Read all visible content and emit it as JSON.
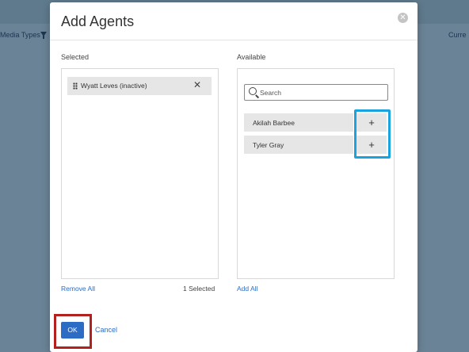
{
  "backdrop": {
    "media_types_label": "Media Types",
    "right_label_partial": "Curre"
  },
  "modal": {
    "title": "Add Agents",
    "close_icon": "close-circle-icon"
  },
  "selected": {
    "label": "Selected",
    "items": [
      {
        "name": "Wyatt Leves (inactive)"
      }
    ],
    "remove_all": "Remove All",
    "count_text": "1 Selected"
  },
  "available": {
    "label": "Available",
    "search": {
      "placeholder": "Search",
      "value": ""
    },
    "items": [
      {
        "name": "Akilah Barbee",
        "action": "+"
      },
      {
        "name": "Tyler Gray",
        "action": "+"
      }
    ],
    "add_all": "Add All"
  },
  "footer": {
    "ok_label": "OK",
    "cancel_label": "Cancel"
  },
  "annotations": {
    "add_buttons_highlight_color": "#1aa3de",
    "ok_highlight_color": "#b2211e"
  },
  "colors": {
    "accent": "#2d6cc5",
    "item_bg": "#e6e6e6",
    "backdrop": "#6a8396"
  }
}
